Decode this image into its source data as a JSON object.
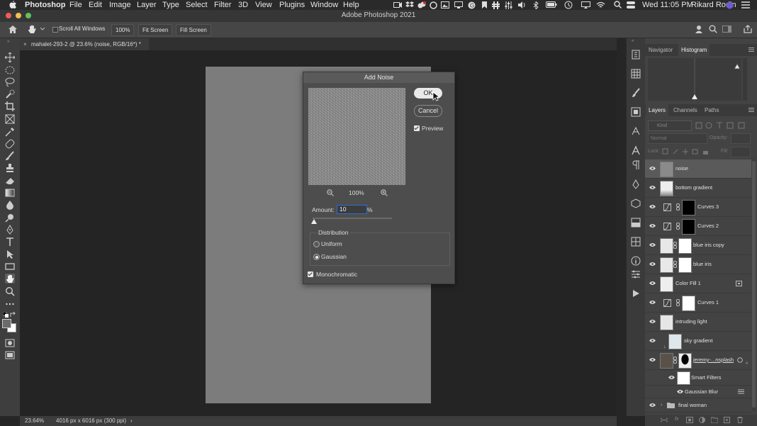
{
  "menubar": {
    "app": "Photoshop",
    "items": [
      "File",
      "Edit",
      "Image",
      "Layer",
      "Type",
      "Select",
      "Filter",
      "3D",
      "View",
      "Plugins",
      "Window",
      "Help"
    ],
    "clock": "Wed 11:05 PM",
    "user": "Rikard Rodin"
  },
  "window": {
    "title": "Adobe Photoshop 2021"
  },
  "options": {
    "scroll_all": "Scroll All Windows",
    "zoom": "100%",
    "fit_screen": "Fit Screen",
    "fill_screen": "Fill Screen"
  },
  "document": {
    "tab_title": "mahalet-293-2 @ 23.6% (noise, RGB/16*) *"
  },
  "status": {
    "zoom": "23.64%",
    "info": "4016 px x 6016 px (300 ppi)"
  },
  "dialog": {
    "title": "Add Noise",
    "ok": "OK",
    "cancel": "Cancel",
    "preview_label": "Preview",
    "preview_checked": true,
    "zoom": "100%",
    "amount_label": "Amount:",
    "amount_value": "10",
    "amount_unit": "%",
    "amount_slider_level": 0.02,
    "distribution_label": "Distribution",
    "uniform": "Uniform",
    "gaussian": "Gaussian",
    "selected_distribution": "Gaussian",
    "monochromatic": "Monochromatic",
    "monochromatic_checked": true
  },
  "panels": {
    "top_tabs": [
      "Navigator",
      "Histogram"
    ],
    "top_active": "Histogram",
    "layer_tabs": [
      "Layers",
      "Channels",
      "Paths"
    ],
    "layer_active": "Layers",
    "kind_placeholder": "Kind",
    "blend_mode": "Normal",
    "opacity_label": "Opacity:",
    "lock_label": "Lock:",
    "fill_label": "Fill:"
  },
  "layers": [
    {
      "name": "noise",
      "selected": true
    },
    {
      "name": "bottom gradient"
    },
    {
      "name": "Curves 3"
    },
    {
      "name": "Curves 2"
    },
    {
      "name": "blue iris copy"
    },
    {
      "name": "blue iris"
    },
    {
      "name": "Color Fill 1"
    },
    {
      "name": "Curves 1"
    },
    {
      "name": "intruding light"
    },
    {
      "name": "sky gradient"
    },
    {
      "name": "jeremy-...nsplash"
    },
    {
      "name": "Smart Filters"
    },
    {
      "name": "Gaussian Blur"
    },
    {
      "name": "final woman"
    }
  ]
}
